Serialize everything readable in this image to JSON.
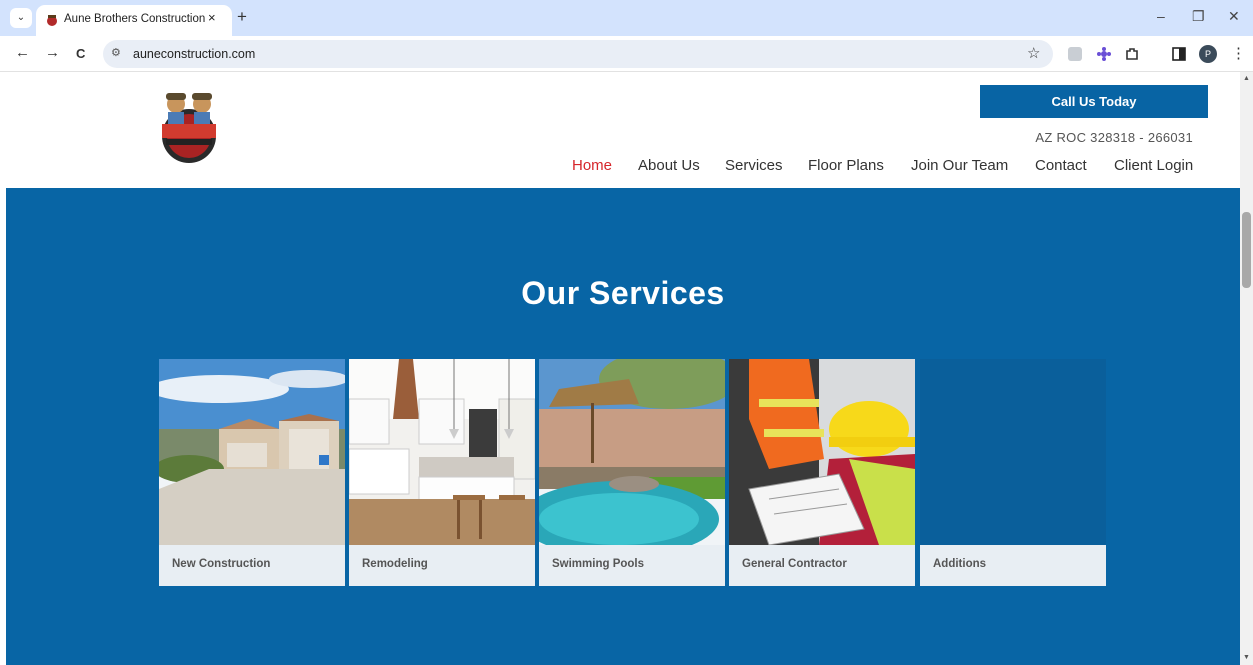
{
  "browser": {
    "tab_title": "Aune Brothers Construction",
    "tab_close": "×",
    "new_tab": "+",
    "url": "auneconstruction.com",
    "tab_dropdown": "⌄",
    "back": "←",
    "forward": "→",
    "reload": "C",
    "star": "☆",
    "profile_initial": "P",
    "menu": "⋮",
    "minimize": "–",
    "restore": "❐",
    "close": "✕"
  },
  "header": {
    "call_button": "Call Us Today",
    "license": "AZ ROC 328318 - 266031",
    "nav": [
      "Home",
      "About Us",
      "Services",
      "Floor Plans",
      "Join Our Team",
      "Contact",
      "Client Login"
    ],
    "active_nav": "Home"
  },
  "services": {
    "title": "Our Services",
    "cards": [
      {
        "label": "New Construction"
      },
      {
        "label": "Remodeling"
      },
      {
        "label": "Swimming Pools"
      },
      {
        "label": "General Contractor"
      },
      {
        "label": "Additions"
      }
    ]
  },
  "colors": {
    "brand_blue": "#0865a5",
    "active_red": "#d6262b",
    "tab_bar": "#d3e3fd"
  }
}
